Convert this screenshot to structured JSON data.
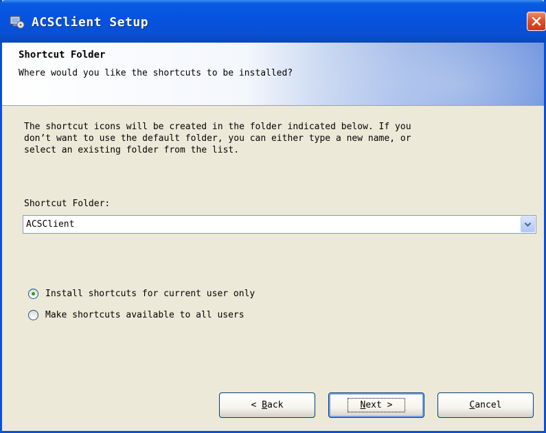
{
  "window": {
    "title": "ACSClient Setup"
  },
  "banner": {
    "heading": "Shortcut Folder",
    "subheading": "Where would you like the shortcuts to be installed?"
  },
  "content": {
    "description": "The shortcut icons will be created in the folder indicated below. If you\ndon’t want to use the default folder, you can either type a new name, or\nselect an existing folder from the list.",
    "folder_label": "Shortcut Folder:",
    "folder_value": "ACSClient",
    "options": [
      {
        "label": "Install shortcuts for current user only",
        "selected": true
      },
      {
        "label": "Make shortcuts available to all users",
        "selected": false
      }
    ]
  },
  "buttons": {
    "back": {
      "prefix": "< ",
      "mnemonic": "B",
      "rest": "ack"
    },
    "next": {
      "mnemonic": "N",
      "rest": "ext",
      "suffix": " >"
    },
    "cancel": {
      "mnemonic": "C",
      "rest": "ancel"
    }
  },
  "colors": {
    "titlebar": "#0553e0",
    "close_button": "#e0502c",
    "dialog_background": "#ece9d8",
    "radio_selected": "#21a121"
  }
}
